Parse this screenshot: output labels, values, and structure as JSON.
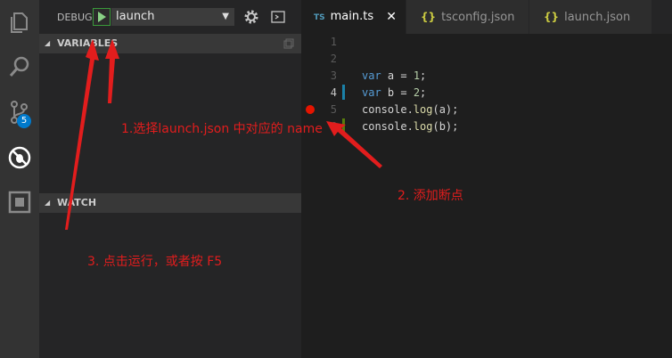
{
  "sidebar": {
    "debug_label": "DEBUG",
    "config_select": "launch",
    "badge_count": "5",
    "sections": {
      "variables": "VARIABLES",
      "watch": "WATCH"
    }
  },
  "tabs": [
    {
      "label": "main.ts",
      "icon": "TS",
      "active": true
    },
    {
      "label": "tsconfig.json",
      "icon": "{}"
    },
    {
      "label": "launch.json",
      "icon": "{}"
    }
  ],
  "editor": {
    "line_numbers": [
      "1",
      "2",
      "3",
      "4",
      "5",
      "6"
    ],
    "lines": [
      {
        "n": 3,
        "parts": [
          [
            "kw",
            "var"
          ],
          [
            "t",
            " a = "
          ],
          [
            "num",
            "1"
          ],
          [
            "t",
            ";"
          ]
        ]
      },
      {
        "n": 4,
        "parts": [
          [
            "kw",
            "var"
          ],
          [
            "t",
            " b = "
          ],
          [
            "num",
            "2"
          ],
          [
            "t",
            ";"
          ]
        ]
      },
      {
        "n": 5,
        "parts": [
          [
            "t",
            "console."
          ],
          [
            "fn",
            "log"
          ],
          [
            "t",
            "(a);"
          ]
        ]
      },
      {
        "n": 6,
        "parts": [
          [
            "t",
            "console."
          ],
          [
            "fn",
            "log"
          ],
          [
            "t",
            "(b);"
          ]
        ]
      }
    ]
  },
  "annotations": {
    "step1": "1.选择launch.json 中对应的 name",
    "step2": "2. 添加断点",
    "step3": "3. 点击运行，或者按 F5"
  },
  "colors": {
    "accent": "#007acc",
    "annotation": "#e21d1d",
    "breakpoint": "#e51400",
    "play": "#89d185"
  }
}
